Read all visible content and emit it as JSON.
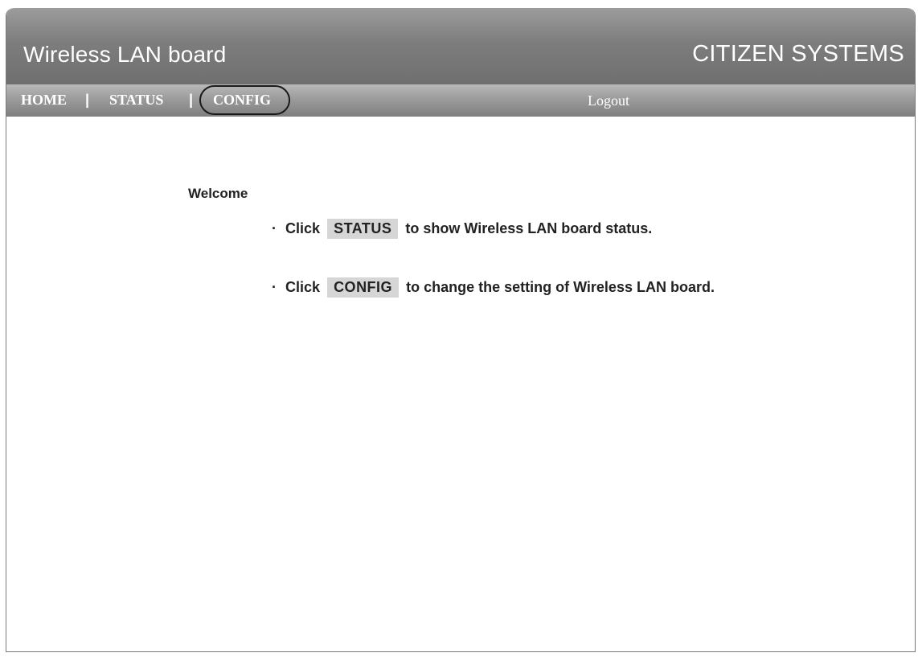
{
  "header": {
    "title": "Wireless LAN board",
    "brand": "CITIZEN SYSTEMS"
  },
  "nav": {
    "home": "HOME",
    "status": "STATUS",
    "config": "CONFIG",
    "separator": "|",
    "logout": "Logout"
  },
  "main": {
    "welcome": "Welcome",
    "line1": {
      "bullet": "·",
      "prefix": "Click",
      "keyword": "STATUS",
      "suffix": "to show Wireless LAN board status."
    },
    "line2": {
      "bullet": "·",
      "prefix": "Click",
      "keyword": "CONFIG",
      "suffix": "to change the setting of Wireless LAN board."
    }
  },
  "colors": {
    "header_gray": "#7d7d7d",
    "nav_gray": "#9b9b9b",
    "chip_gray": "#d6d6d6",
    "text": "#222222"
  }
}
